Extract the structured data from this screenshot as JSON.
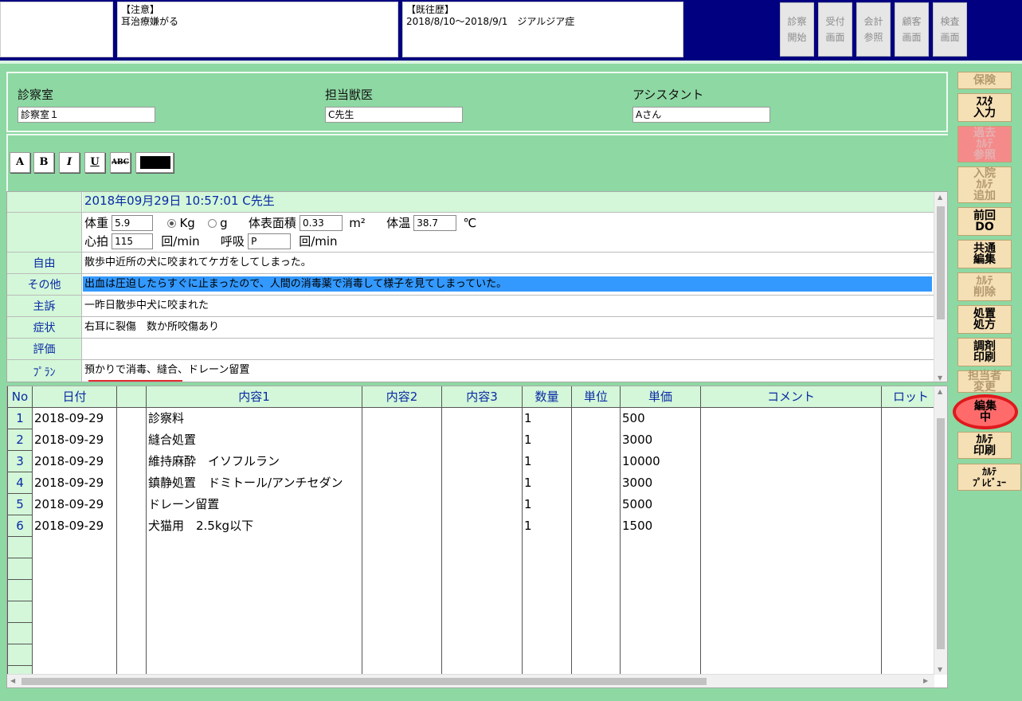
{
  "header": {
    "notice": {
      "title": "【注意】",
      "text": "耳治療嫌がる"
    },
    "history": {
      "title": "【既往歴】",
      "text": "2018/8/10～2018/9/1　ジアルジア症"
    },
    "buttons": [
      "診察\n開始",
      "受付\n画面",
      "会計\n参照",
      "顧客\n画面",
      "検査\n画面"
    ]
  },
  "info": {
    "room_label": "診察室",
    "room_value": "診察室１",
    "vet_label": "担当獣医",
    "vet_value": "C先生",
    "assistant_label": "アシスタント",
    "assistant_value": "Aさん"
  },
  "toolbar": {
    "font_icon": "A",
    "bold_icon": "B",
    "italic_icon": "I",
    "underline_icon": "U",
    "strike_icon": "ABC",
    "color": "#000000"
  },
  "record": {
    "header": "2018年09月29日 10:57:01 C先生",
    "vitals": {
      "weight_label": "体重",
      "weight_value": "5.9",
      "unit_kg": "Kg",
      "unit_g": "g",
      "bsa_label": "体表面積",
      "bsa_value": "0.33",
      "bsa_unit": "m²",
      "temp_label": "体温",
      "temp_value": "38.7",
      "temp_unit": "℃",
      "pulse_label": "心拍",
      "pulse_value": "115",
      "pulse_unit": "回/min",
      "resp_label": "呼吸",
      "resp_value": "P",
      "resp_unit": "回/min"
    },
    "rows": [
      {
        "label": "自由",
        "text": "散歩中近所の犬に咬まれてケガをしてしまった。"
      },
      {
        "label": "その他",
        "text": "出血は圧迫したらすぐに止まったので、人間の消毒薬で消毒して様子を見てしまっていた。"
      },
      {
        "label": "主訴",
        "text": "一昨日散歩中犬に咬まれた"
      },
      {
        "label": "症状",
        "text": "右耳に裂傷　数か所咬傷あり"
      },
      {
        "label": "評価",
        "text": ""
      },
      {
        "label": "ﾌﾟﾗﾝ",
        "text": "預かりで消毒、縫合、ドレーン留置"
      }
    ]
  },
  "billing": {
    "columns": [
      "No",
      "日付",
      "",
      "内容1",
      "内容2",
      "内容3",
      "数量",
      "単位",
      "単価",
      "コメント",
      "ロット"
    ],
    "rows": [
      {
        "no": "1",
        "date": "2018-09-29",
        "content1": "診察料",
        "qty": "1",
        "price": "500"
      },
      {
        "no": "2",
        "date": "2018-09-29",
        "content1": "縫合処置",
        "qty": "1",
        "price": "3000"
      },
      {
        "no": "3",
        "date": "2018-09-29",
        "content1": "維持麻酔　イソフルラン",
        "qty": "1",
        "price": "10000"
      },
      {
        "no": "4",
        "date": "2018-09-29",
        "content1": "鎮静処置　ドミトール/アンチセダン",
        "qty": "1",
        "price": "3000"
      },
      {
        "no": "5",
        "date": "2018-09-29",
        "content1": "ドレーン留置",
        "qty": "1",
        "price": "5000"
      },
      {
        "no": "6",
        "date": "2018-09-29",
        "content1": "犬猫用　2.5kg以下",
        "qty": "1",
        "price": "1500"
      }
    ]
  },
  "side_buttons": [
    {
      "label": "保険",
      "state": "dim"
    },
    {
      "label": "ｽｽﾀ\n入力",
      "state": "normal"
    },
    {
      "label": "過去\nｶﾙﾃ\n参照",
      "state": "pink"
    },
    {
      "label": "入院\nｶﾙﾃ\n追加",
      "state": "dim"
    },
    {
      "label": "前回\nDO",
      "state": "normal"
    },
    {
      "label": "共通\n編集",
      "state": "normal"
    },
    {
      "label": "ｶﾙﾃ\n削除",
      "state": "dim"
    },
    {
      "label": "処置\n処方",
      "state": "normal"
    },
    {
      "label": "調剤\n印刷",
      "state": "normal"
    },
    {
      "label": "担当者\n変更",
      "state": "dim"
    },
    {
      "label": "編集\n中",
      "state": "active"
    },
    {
      "label": "ｶﾙﾃ\n印刷",
      "state": "normal"
    },
    {
      "label": "ｶﾙﾃ\nﾌﾟﾚﾋﾞｭｰ",
      "state": "normal"
    }
  ]
}
